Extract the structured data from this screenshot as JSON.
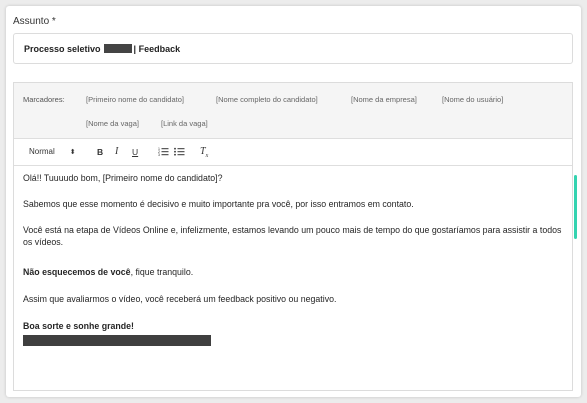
{
  "subject": {
    "label": "Assunto *",
    "value_prefix": "Processo seletivo",
    "value_suffix": "| Feedback"
  },
  "markers": {
    "label": "Marcadores:",
    "tags": [
      "[Primeiro nome do candidato]",
      "[Nome completo do candidato]",
      "[Nome da empresa]",
      "[Nome do usuário]",
      "[Nome da vaga]",
      "[Link da vaga]"
    ]
  },
  "toolbar": {
    "format_select": "Normal",
    "format_arrows": "⬍",
    "bold": "B",
    "italic": "I",
    "underline": "U",
    "ordered_list": "⅓",
    "bullet_list": "☰",
    "clear_format": "T"
  },
  "body": {
    "p1": "Olá!! Tuuuudo bom, [Primeiro nome do candidato]?",
    "p2": "Sabemos que esse momento é decisivo e muito importante pra você, por isso entramos em contato.",
    "p3": "Você está na etapa de Vídeos Online e, infelizmente, estamos levando um pouco mais de tempo do que gostaríamos para assistir a todos os vídeos.",
    "p4_bold": "Não esquecemos de você",
    "p4_rest": ", fique tranquilo.",
    "p5": "Assim que avaliarmos o vídeo, você receberá um feedback positivo ou negativo.",
    "p6": "Boa sorte e sonhe grande!"
  },
  "colors": {
    "scroll_accent": "#34d3b0"
  }
}
